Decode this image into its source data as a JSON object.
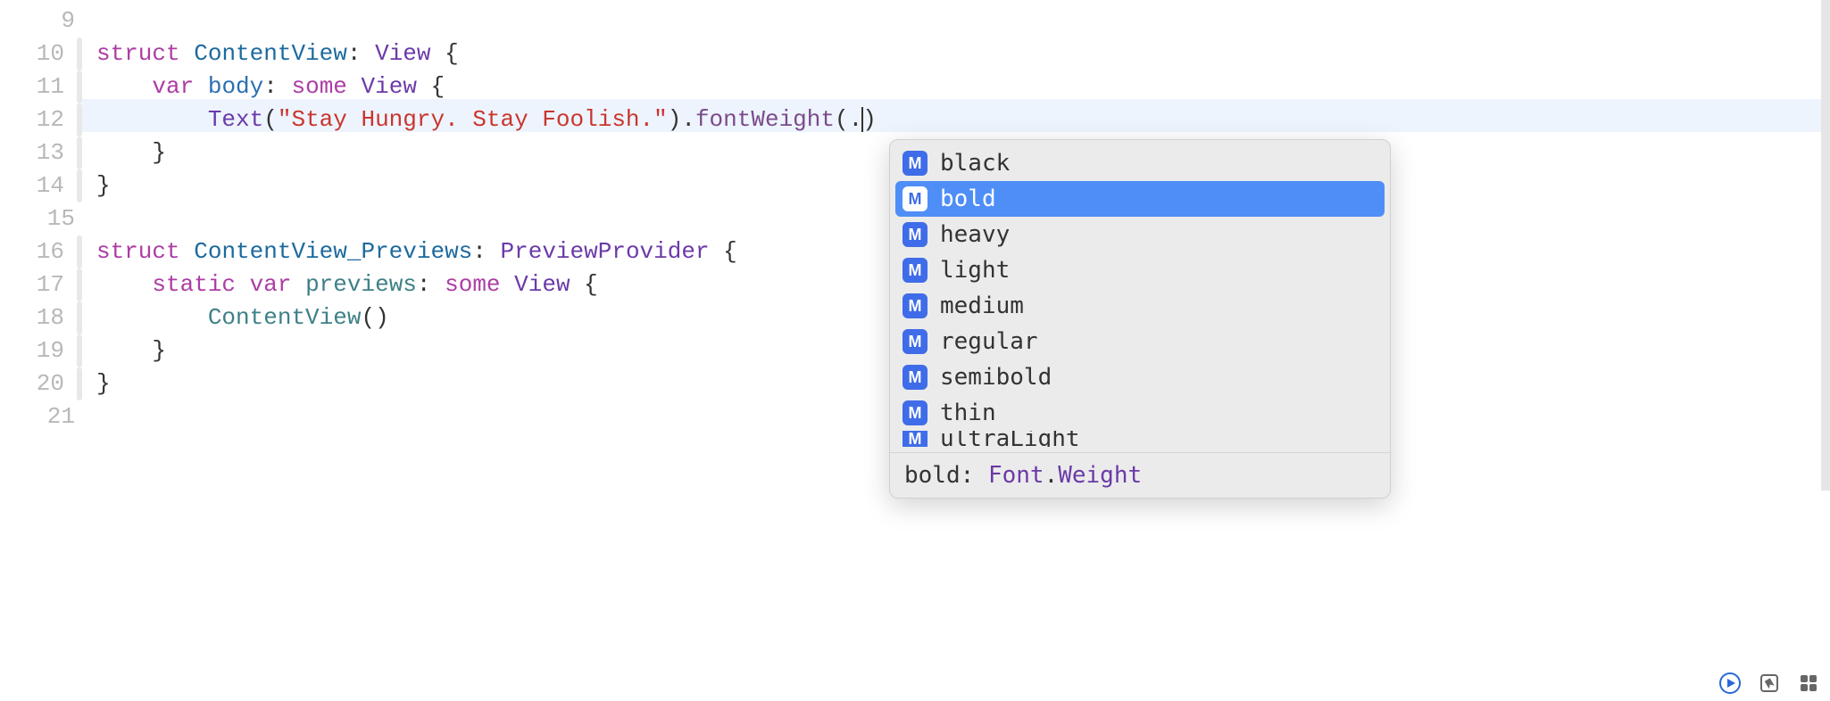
{
  "gutter": {
    "lines": [
      9,
      10,
      11,
      12,
      13,
      14,
      15,
      16,
      17,
      18,
      19,
      20,
      21
    ],
    "foldable": [
      10,
      11,
      12,
      13,
      14,
      16,
      17,
      18,
      19,
      20
    ]
  },
  "active_line": 12,
  "code": {
    "l10": {
      "kw1": "struct",
      "type1": "ContentView",
      "colon": ":",
      "type2": "View",
      "brace": " {"
    },
    "l11": {
      "indent": "    ",
      "kw1": "var",
      "id1": "body",
      "colon": ":",
      "kw2": "some",
      "type1": "View",
      "brace": " {"
    },
    "l12": {
      "indent": "        ",
      "type1": "Text",
      "lparen": "(",
      "string": "\"Stay Hungry. Stay Foolish.\"",
      "rparen": ")",
      "dot": ".",
      "method": "fontWeight",
      "lparen2": "(",
      "dot2": ".",
      "rparen2": ")"
    },
    "l13": {
      "indent": "    ",
      "brace": "}"
    },
    "l14": {
      "brace": "}"
    },
    "l16": {
      "kw1": "struct",
      "type1": "ContentView_Previews",
      "colon": ":",
      "type2": "PreviewProvider",
      "brace": " {"
    },
    "l17": {
      "indent": "    ",
      "kw1": "static",
      "kw2": "var",
      "id1": "previews",
      "colon": ":",
      "kw3": "some",
      "type1": "View",
      "brace": " {"
    },
    "l18": {
      "indent": "        ",
      "type1": "ContentView",
      "parens": "()"
    },
    "l19": {
      "indent": "    ",
      "brace": "}"
    },
    "l20": {
      "brace": "}"
    }
  },
  "autocomplete": {
    "icon_letter": "M",
    "items": [
      {
        "label": "black",
        "selected": false
      },
      {
        "label": "bold",
        "selected": true
      },
      {
        "label": "heavy",
        "selected": false
      },
      {
        "label": "light",
        "selected": false
      },
      {
        "label": "medium",
        "selected": false
      },
      {
        "label": "regular",
        "selected": false
      },
      {
        "label": "semibold",
        "selected": false
      },
      {
        "label": "thin",
        "selected": false
      },
      {
        "label": "ultraLight",
        "selected": false
      }
    ],
    "footer": {
      "name": "bold",
      "sep": ": ",
      "type_ns": "Font",
      "type_dot": ".",
      "type_name": "Weight"
    }
  }
}
